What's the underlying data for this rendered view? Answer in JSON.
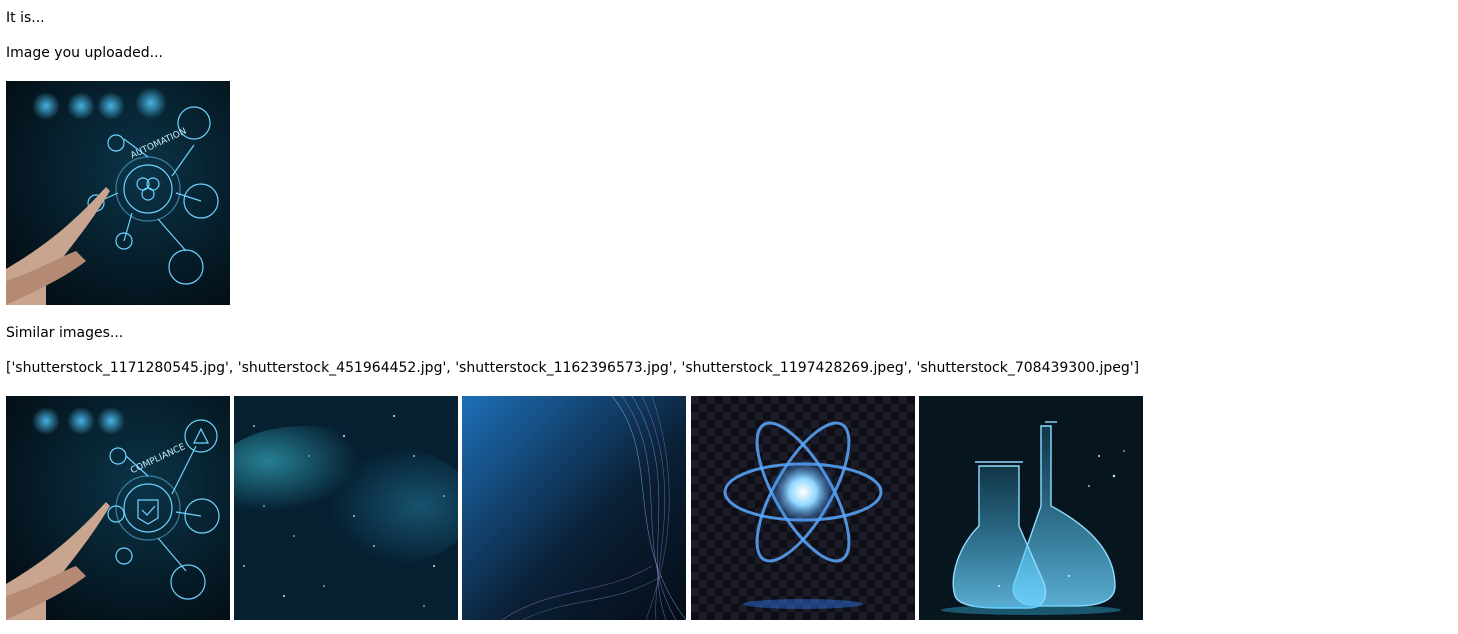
{
  "header_text": "It is...",
  "uploaded_label": "Image you uploaded...",
  "uploaded_image": {
    "icon": "automation-hand-image",
    "caption": "AUTOMATION"
  },
  "similar_label": "Similar images...",
  "similar_list_text": "['shutterstock_1171280545.jpg', 'shutterstock_451964452.jpg', 'shutterstock_1162396573.jpg', 'shutterstock_1197428269.jpeg', 'shutterstock_708439300.jpeg']",
  "similar_images": [
    {
      "file": "shutterstock_1171280545.jpg",
      "icon": "compliance-hand-image",
      "caption": "COMPLIANCE"
    },
    {
      "file": "shutterstock_451964452.jpg",
      "icon": "starry-nebula-image"
    },
    {
      "file": "shutterstock_1162396573.jpg",
      "icon": "network-wave-image"
    },
    {
      "file": "shutterstock_1197428269.jpeg",
      "icon": "atom-image"
    },
    {
      "file": "shutterstock_708439300.jpeg",
      "icon": "lab-flasks-image"
    }
  ],
  "colors": {
    "text": "#000000",
    "background": "#ffffff",
    "image_dark": "#041019",
    "image_glow": "#3ab8e8"
  }
}
